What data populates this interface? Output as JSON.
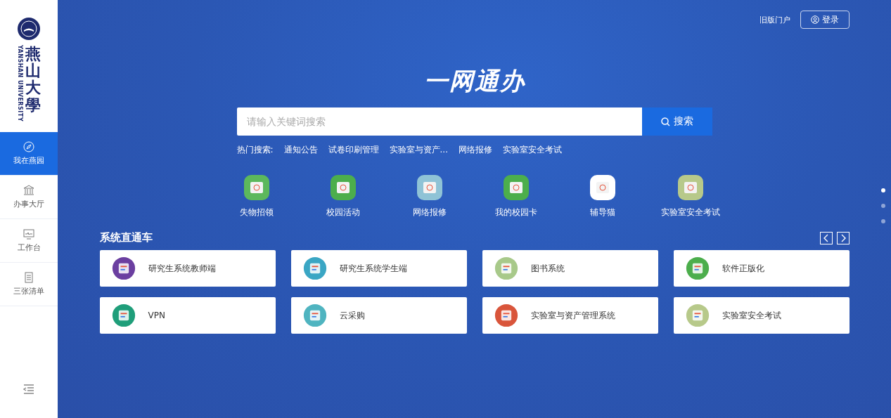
{
  "logo": {
    "name_cn": "燕山大學",
    "name_en": "YANSHAN UNIVERSITY"
  },
  "sidebar": {
    "items": [
      {
        "label": "我在燕园",
        "kind": "compass",
        "selected": true
      },
      {
        "label": "办事大厅",
        "kind": "hall",
        "selected": false
      },
      {
        "label": "工作台",
        "kind": "monitor",
        "selected": false
      },
      {
        "label": "三张清单",
        "kind": "document",
        "selected": false
      }
    ]
  },
  "header": {
    "old_portal": "旧版门户",
    "login": "登录"
  },
  "hero": {
    "title": "一网通办",
    "search": {
      "placeholder": "请输入关键词搜索",
      "button": "搜索"
    },
    "hot_label": "热门搜索:",
    "hot_items": [
      "通知公告",
      "试卷印刷管理",
      "实验室与资产...",
      "网络报修",
      "实验室安全考试"
    ]
  },
  "quick_links": [
    {
      "label": "失物招领",
      "color": "#5cb85c"
    },
    {
      "label": "校园活动",
      "color": "#4cae4c"
    },
    {
      "label": "网络报修",
      "color": "#8fc3d6"
    },
    {
      "label": "我的校园卡",
      "color": "#4cae4c"
    },
    {
      "label": "辅导猫",
      "color": "#ffffff"
    },
    {
      "label": "实验室安全考试",
      "color": "#b7c98a"
    }
  ],
  "systems": {
    "title": "系统直通车",
    "cards": [
      {
        "label": "研究生系统教师端",
        "color": "#6b3fa0"
      },
      {
        "label": "研究生系统学生端",
        "color": "#3aa6c4"
      },
      {
        "label": "图书系统",
        "color": "#a8c98a"
      },
      {
        "label": "软件正版化",
        "color": "#4cae4c"
      },
      {
        "label": "VPN",
        "color": "#1f9e7a"
      },
      {
        "label": "云采购",
        "color": "#4fb4c0"
      },
      {
        "label": "实验室与资产管理系统",
        "color": "#d9553b"
      },
      {
        "label": "实验室安全考试",
        "color": "#b7c98a"
      }
    ]
  },
  "pager_dots": [
    {
      "selected": true
    },
    {
      "selected": false
    },
    {
      "selected": false
    }
  ]
}
